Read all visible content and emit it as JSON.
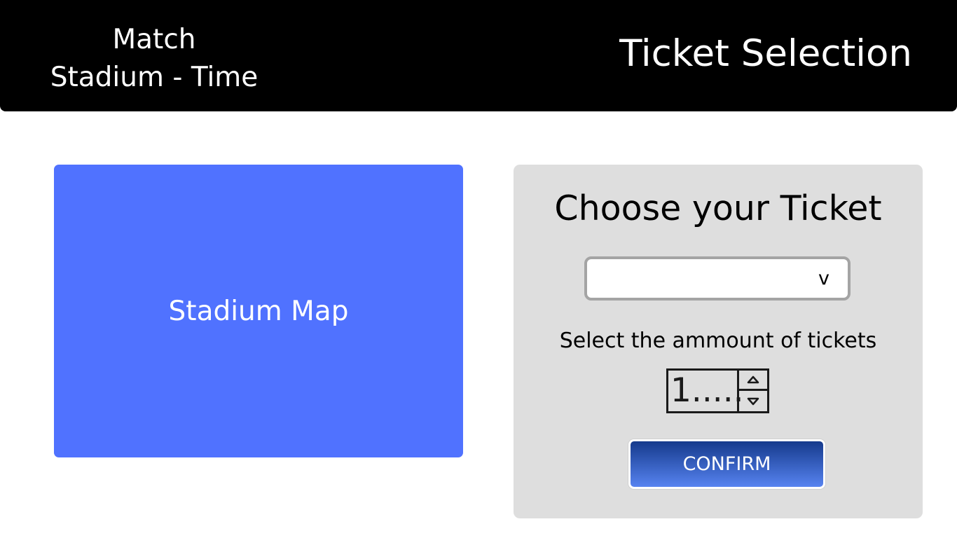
{
  "header": {
    "match_line1": "Match",
    "match_line2": "Stadium - Time",
    "title": "Ticket Selection"
  },
  "map": {
    "label": "Stadium Map",
    "color": "#5072ff"
  },
  "ticket_panel": {
    "title": "Choose your Ticket",
    "select": {
      "value": "",
      "chevron": "v"
    },
    "amount_label": "Select the ammount of tickets",
    "quantity": {
      "value": "1.....",
      "up_icon": "chevron-up-icon",
      "down_icon": "chevron-down-icon"
    },
    "confirm_label": "CONFIRM"
  },
  "colors": {
    "header_bg": "#000000",
    "panel_bg": "#dedede",
    "confirm_gradient_top": "#153a8c",
    "confirm_gradient_bottom": "#5783f0"
  }
}
